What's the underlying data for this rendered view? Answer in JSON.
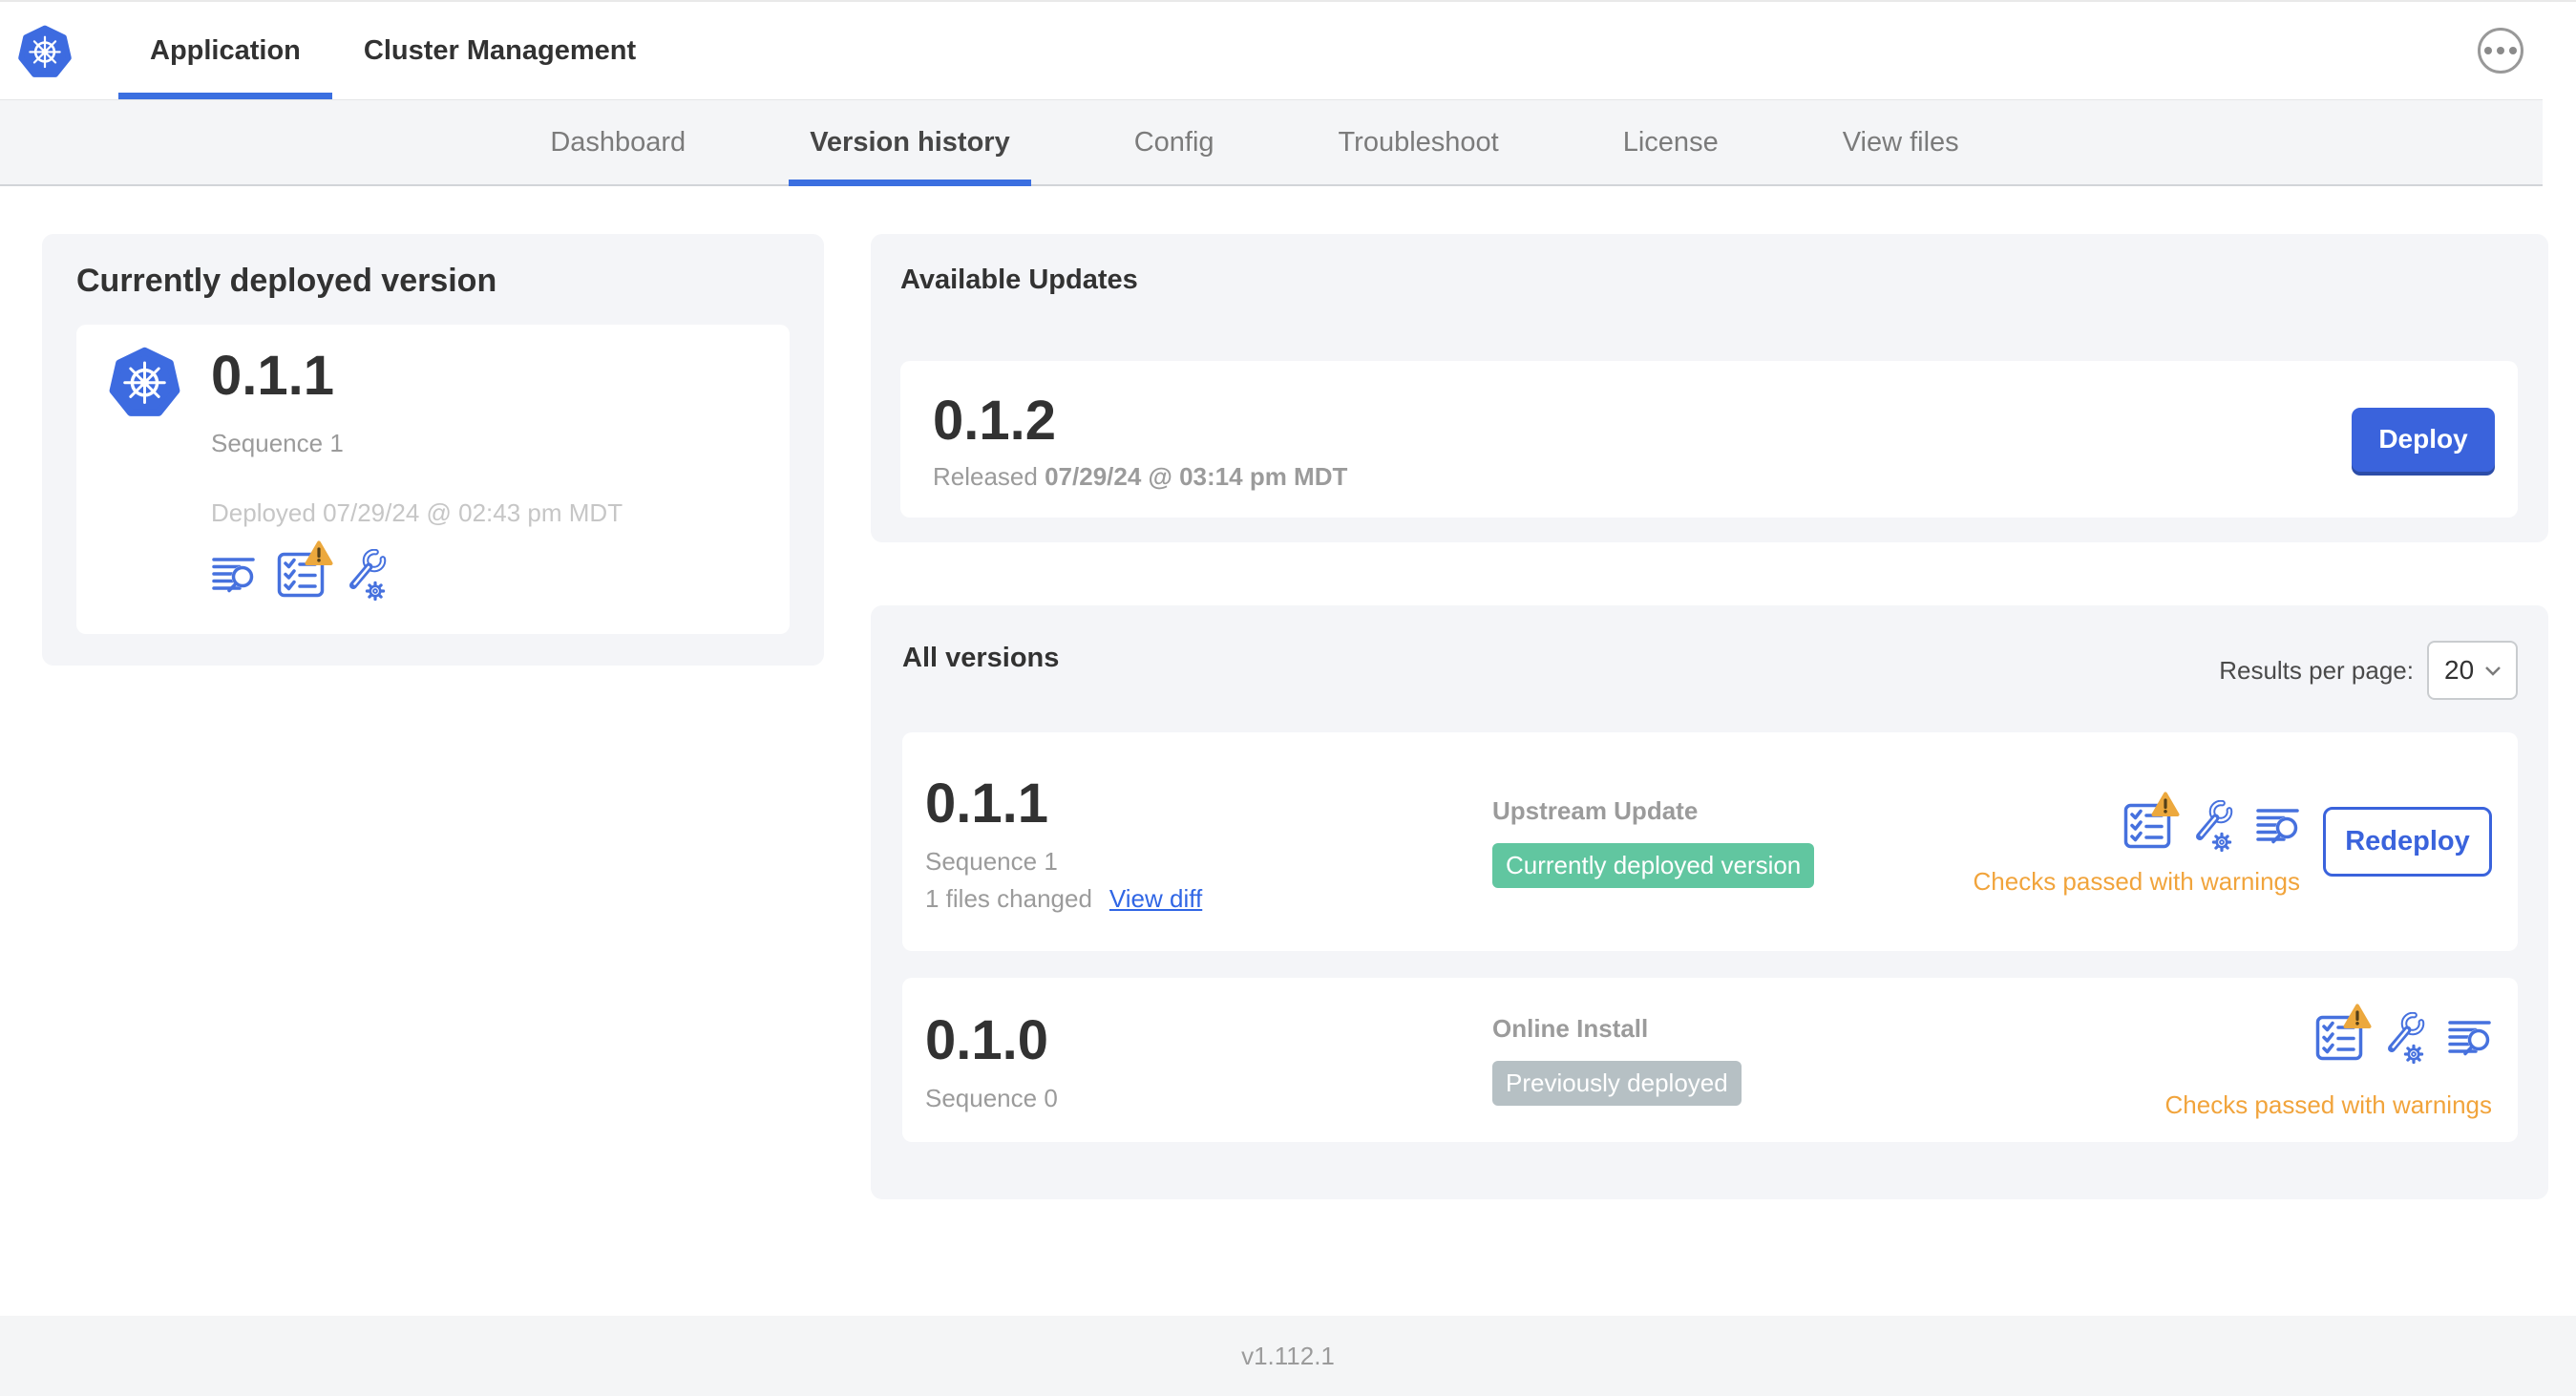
{
  "header": {
    "tabs": [
      {
        "label": "Application",
        "active": true
      },
      {
        "label": "Cluster Management",
        "active": false
      }
    ],
    "menu_icon": "ellipsis-menu"
  },
  "nav": {
    "tabs": [
      {
        "label": "Dashboard",
        "active": false
      },
      {
        "label": "Version history",
        "active": true
      },
      {
        "label": "Config",
        "active": false
      },
      {
        "label": "Troubleshoot",
        "active": false
      },
      {
        "label": "License",
        "active": false
      },
      {
        "label": "View files",
        "active": false
      }
    ]
  },
  "current_version_card": {
    "title": "Currently deployed version",
    "version": "0.1.1",
    "sequence": "Sequence 1",
    "deployed": "Deployed 07/29/24 @ 02:43 pm MDT",
    "icons": [
      "release-notes-icon",
      "preflight-checks-warning-icon",
      "config-icon"
    ]
  },
  "available_updates": {
    "title": "Available Updates",
    "version": "0.1.2",
    "released_label": "Released",
    "released_date": "07/29/24 @ 03:14 pm MDT",
    "deploy_label": "Deploy"
  },
  "all_versions": {
    "title": "All versions",
    "results_per_page_label": "Results per page:",
    "results_per_page_value": "20",
    "rows": [
      {
        "version": "0.1.1",
        "sequence": "Sequence 1",
        "files_changed": "1 files changed",
        "view_diff_label": "View diff",
        "source": "Upstream Update",
        "badge": "Currently deployed version",
        "badge_color": "#61c6a0",
        "action_label": "Redeploy",
        "checks_status": "Checks passed with warnings"
      },
      {
        "version": "0.1.0",
        "sequence": "Sequence 0",
        "source": "Online Install",
        "badge": "Previously deployed",
        "badge_color": "#b6c0c4",
        "checks_status": "Checks passed with warnings"
      }
    ]
  },
  "footer": {
    "app_version": "v1.112.1"
  },
  "colors": {
    "primary_blue": "#3b6fe0",
    "icon_blue": "#4671de",
    "deploy_button": "#3a63dc",
    "warning_orange": "#f1a43c",
    "badge_green": "#61c6a0",
    "badge_gray": "#b6c0c4",
    "subnav_bg": "#f4f5f7",
    "card_bg": "#f4f5f8"
  }
}
